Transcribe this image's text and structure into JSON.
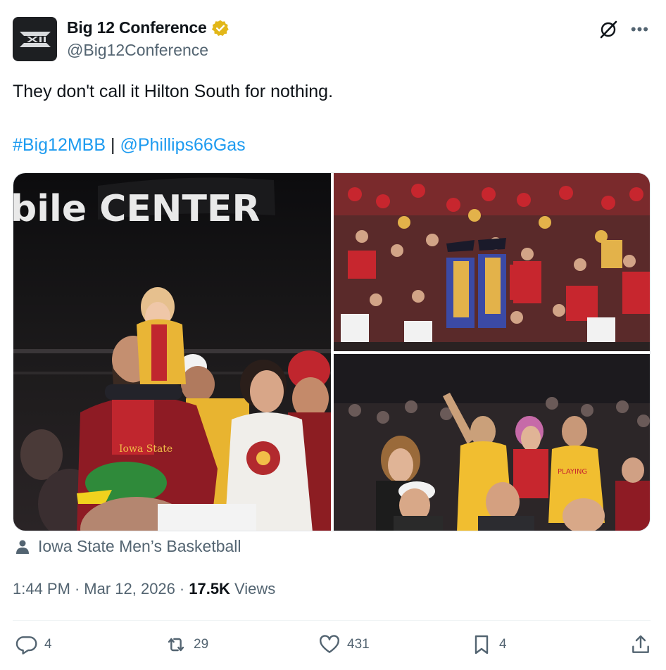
{
  "author": {
    "display_name": "Big 12 Conference",
    "handle": "@Big12Conference",
    "avatar_icon": "big12-logo-icon",
    "verified_color": "#e2b719"
  },
  "tweet": {
    "text": "They don't call it Hilton South for nothing.",
    "hashtag": "#Big12MBB",
    "separator": "|",
    "mention": "@Phillips66Gas"
  },
  "media": {
    "photo1_sign_text": "bile CENTER"
  },
  "location": {
    "icon": "person-icon",
    "label": "Iowa State Men’s Basketball"
  },
  "meta": {
    "time": "1:44 PM",
    "dot1": "·",
    "date": "Mar 12, 2026",
    "dot2": "·",
    "views_count": "17.5K",
    "views_label": "Views"
  },
  "actions": {
    "replies": "4",
    "reposts": "29",
    "likes": "431",
    "bookmarks": "4"
  },
  "colors": {
    "link": "#1d9bf0",
    "secondary_text": "#536471",
    "primary_text": "#0f1419",
    "cardinal": "#c8102e",
    "gold": "#f1be48"
  }
}
